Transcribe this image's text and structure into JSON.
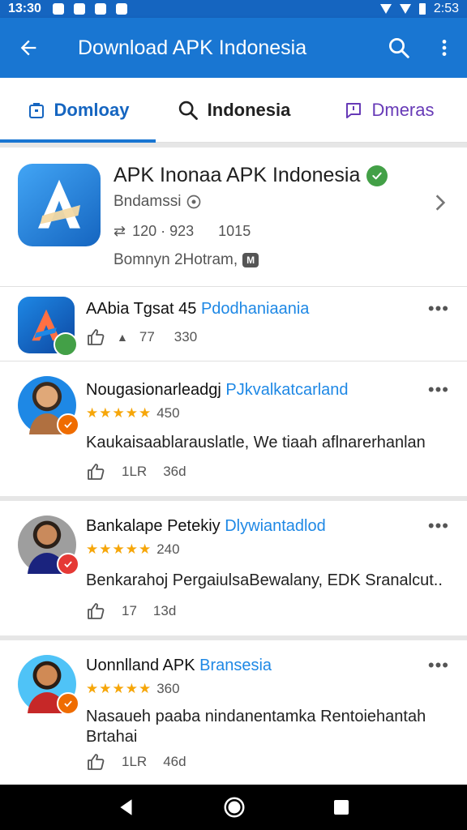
{
  "status_bar": {
    "time_left": "13:30",
    "time_right": "2:53"
  },
  "app_bar": {
    "title": "Download APK Indonesia"
  },
  "tabs": [
    {
      "label": "Domloay",
      "icon": "lock-icon"
    },
    {
      "label": "Indonesia",
      "icon": "search-icon"
    },
    {
      "label": "Dmeras",
      "icon": "message-icon"
    }
  ],
  "featured": {
    "name": "APK Inonaa APK Indonesia",
    "developer": "Bndamssi",
    "stat_downloads": "120 · 923",
    "stat_count": "1015",
    "subtitle": "Bomnyn 2Hotram,",
    "tag": "M"
  },
  "small_app": {
    "title_main": "AAbia Tgsat 45",
    "title_link": "Pdodhaniaania",
    "likes": "77",
    "comments": "330"
  },
  "reviews": [
    {
      "name": "Nougasionarleadgj",
      "link": "PJkvalkatcarland",
      "stars": "★★★★★",
      "rating": "450",
      "text": "Kaukaisaablarauslatle, We tiaah aflnarerhanlan",
      "likes": "1LR",
      "comments": "36d",
      "colors": {
        "face": "#b07040",
        "check": "#ef6c00"
      }
    },
    {
      "name": "Bankalape Petekiy",
      "link": "Dlywiantadlod",
      "stars": "★★★★★",
      "rating": "240",
      "text": "Benkarahoj PergaiulsaBewalany, EDK Sranalcut..",
      "likes": "17",
      "comments": "13d",
      "colors": {
        "face": "#5d4037",
        "check": "#e53935"
      }
    },
    {
      "name": "Uonnlland APK",
      "link": "Bransesia",
      "stars": "★★★★★",
      "rating": "360",
      "text": "Nasaueh paaba nindanentamka Rentoiehantah Brtahai",
      "likes": "1LR",
      "comments": "46d",
      "colors": {
        "face": "#c0692c",
        "check": "#ef6c00"
      }
    }
  ],
  "colors": {
    "primary": "#1976d2",
    "accent_link": "#1e88e5",
    "star": "#f6a609",
    "verified": "#43a047"
  }
}
